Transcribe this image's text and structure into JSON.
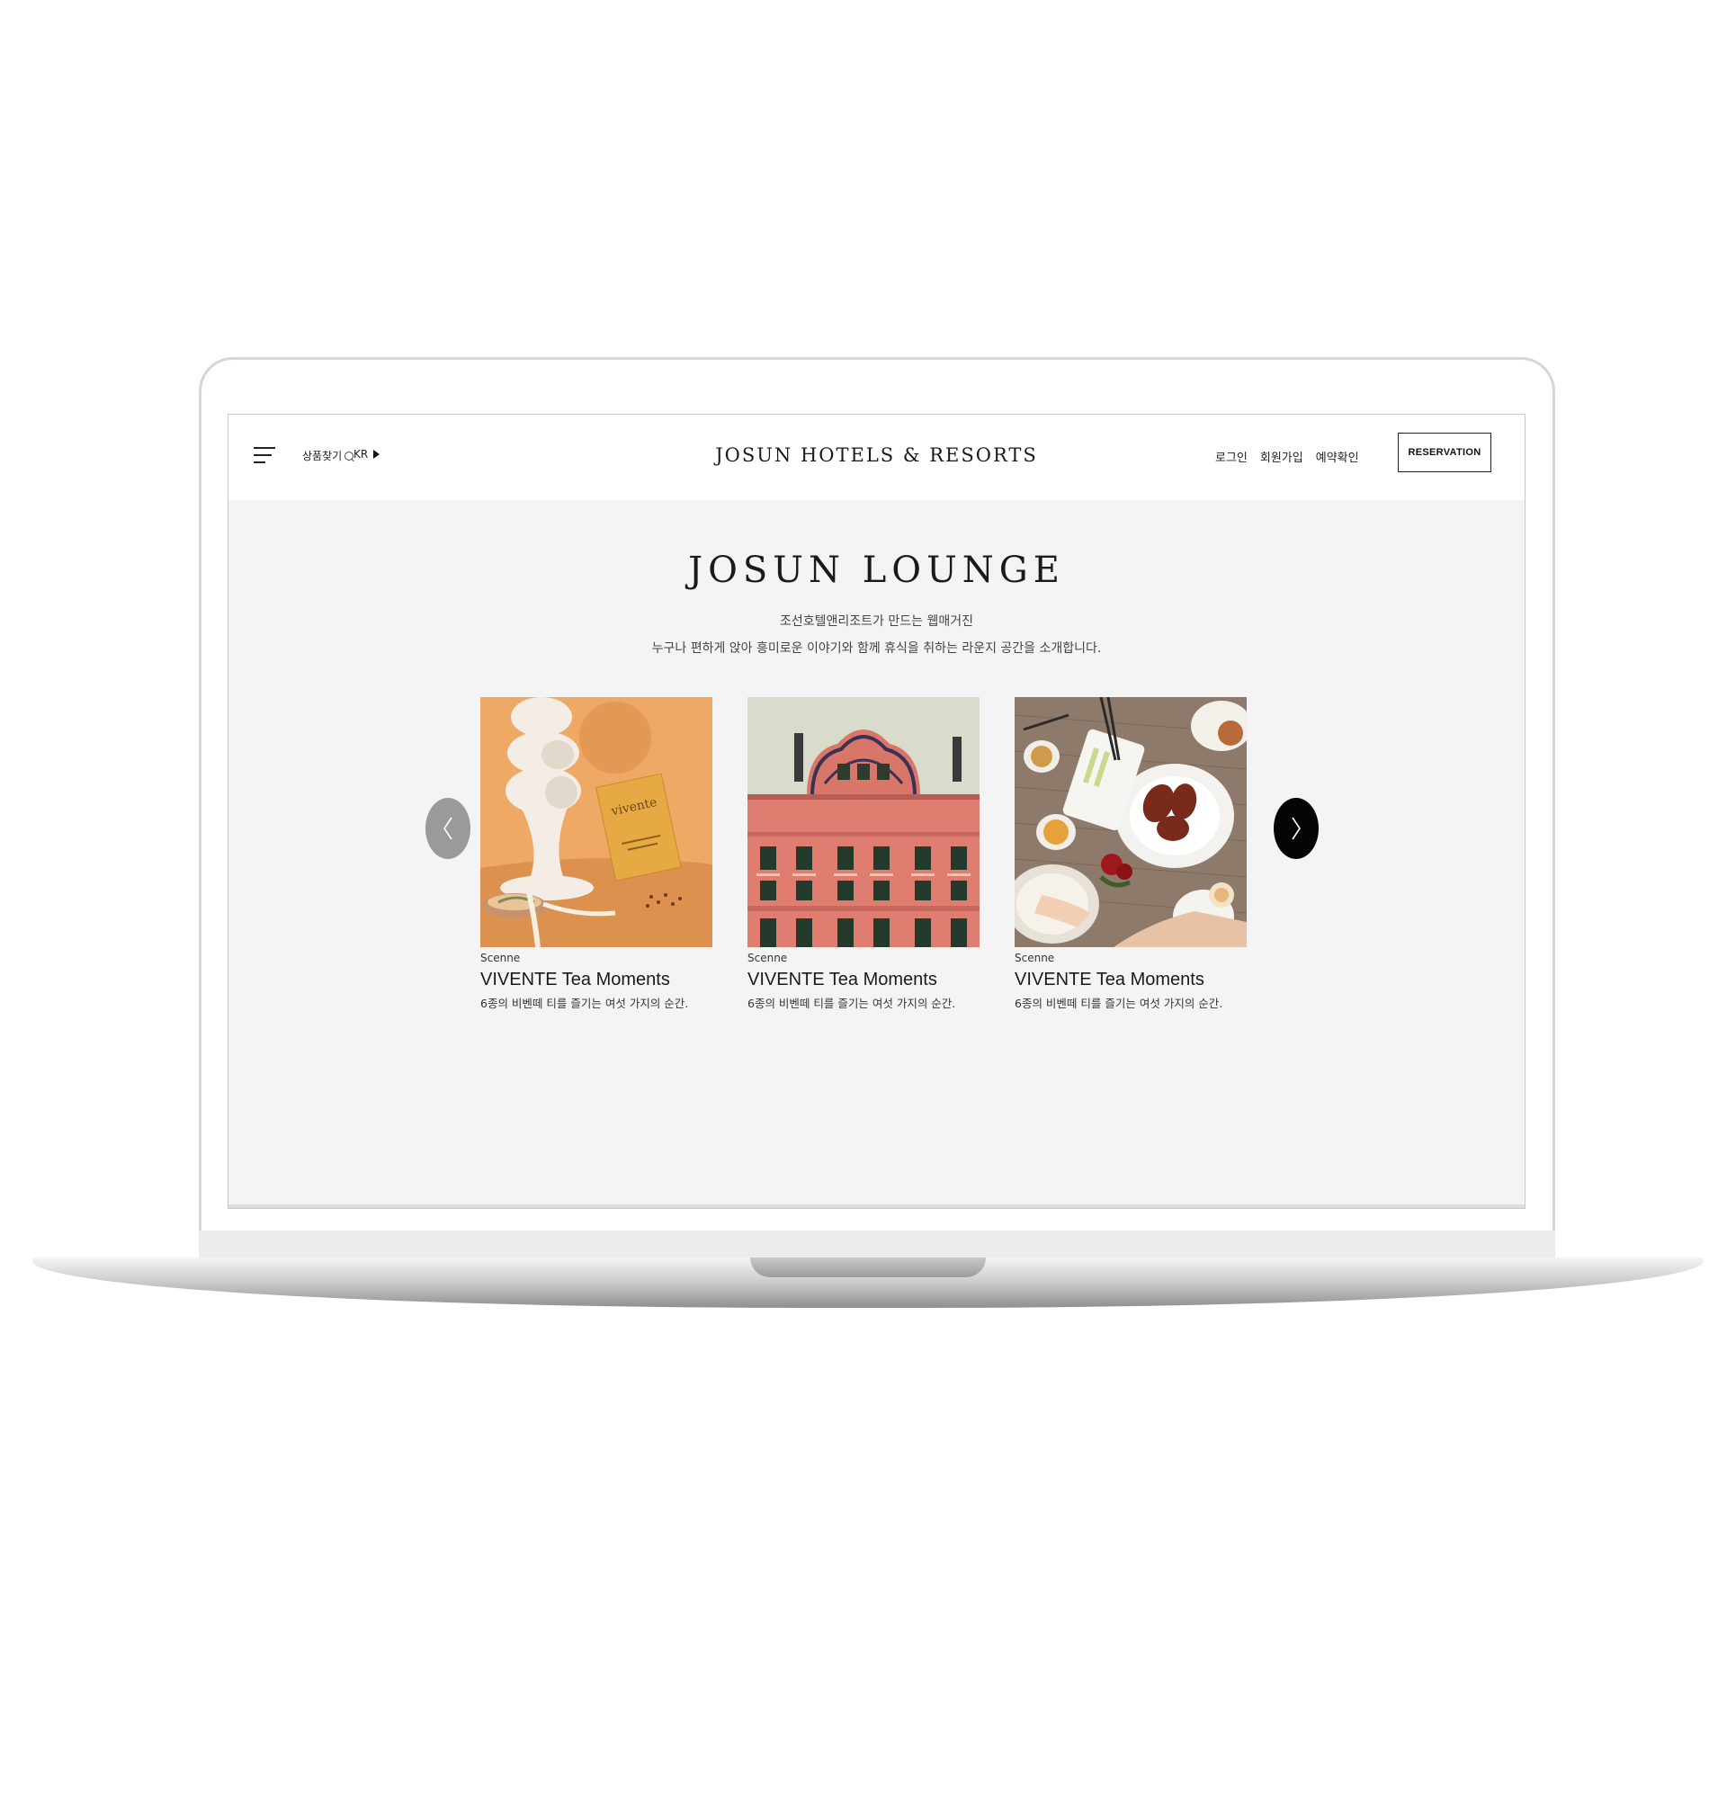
{
  "header": {
    "search_label": "상품찾기",
    "lang_label": "KR",
    "brand": "JOSUN HOTELS & RESORTS",
    "links": [
      "로그인",
      "회원가입",
      "예약확인"
    ],
    "reservation_label": "RESERVATION"
  },
  "lounge": {
    "title": "JOSUN LOUNGE",
    "subtitle_line1": "조선호텔앤리조트가 만드는 웹매거진",
    "subtitle_line2": "누구나 편하게 앉아 흥미로운 이야기와 함께 휴식을 취하는 라운지 공간을 소개합니다."
  },
  "cards": [
    {
      "category": "Scenne",
      "title": "VIVENTE Tea Moments",
      "description": "6종의 비벤떼 티를 즐기는 여섯 가지의 순간.",
      "image": "tea-product-photo",
      "package_text": "vivente"
    },
    {
      "category": "Scenne",
      "title": "VIVENTE Tea Moments",
      "description": "6종의 비벤떼 티를 즐기는 여섯 가지의 순간.",
      "image": "building-illustration"
    },
    {
      "category": "Scenne",
      "title": "VIVENTE Tea Moments",
      "description": "6종의 비벤떼 티를 즐기는 여섯 가지의 순간.",
      "image": "peking-duck-table-photo"
    }
  ],
  "carousel": {
    "prev_icon": "chevron-left-icon",
    "next_icon": "chevron-right-icon"
  },
  "colors": {
    "screen_bg": "#f4f4f4",
    "header_bg": "#ffffff",
    "next_arrow": "#050505",
    "prev_arrow": "#9a9a9a"
  }
}
